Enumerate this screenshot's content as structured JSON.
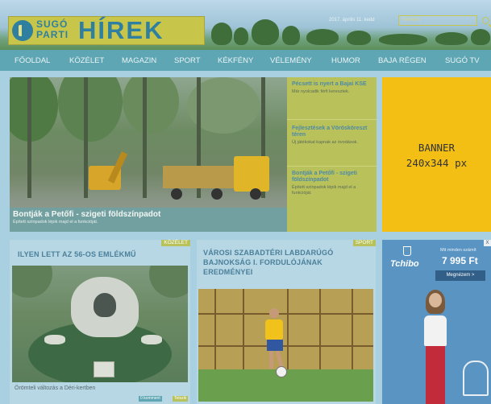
{
  "header": {
    "logo_line1": "SUGÓ",
    "logo_line2": "PARTI",
    "logo_word": "HÍREK",
    "date": "2017. április 11. kedd",
    "search_placeholder": "Keresés"
  },
  "nav": {
    "items": [
      "FŐOLDAL",
      "KÖZÉLET",
      "MAGAZIN",
      "SPORT",
      "KÉKFÉNY",
      "VÉLEMÉNY",
      "HUMOR",
      "BAJA RÉGEN",
      "SUGÓ TV"
    ]
  },
  "hero": {
    "title": "Bontják a Petőfi - szigeti földszínpadot",
    "subtitle": "Épített színpadok lépik majd el a funkcióját."
  },
  "side_news": [
    {
      "title": "Pécsett is nyert a Bajai KSE",
      "text": "Már nyolcadik férfi keresztek."
    },
    {
      "title": "Fejlesztések a Vörösköreszt téren",
      "text": "Új játékokat kapnak az óvodások."
    },
    {
      "title": "Bontják a Petőfi - szigeti földszínpadot",
      "text": "Épített színpadok lépik majd el a funkcióját."
    }
  ],
  "banner": {
    "line1": "BANNER",
    "line2": "240x344 px"
  },
  "article1": {
    "tag": "KÖZÉLET",
    "title": "ILYEN LETT AZ 56-OS EMLÉKMŰ",
    "caption": "Örömteli változás a Déri-kertben",
    "comments": "0 komment",
    "share": "Tetszik"
  },
  "article2": {
    "tag": "SPORT",
    "title_line1": "VÁROSI SZABADTÉRI LABDARÚGÓ",
    "title_line2": "BAJNOKSÁG I. FORDULÓJÁNAK",
    "title_line3": "EREDMÉNYEI"
  },
  "ad": {
    "brand": "Tchibo",
    "small_text": "Mit minden számít",
    "price": "7 995 Ft",
    "button": "Megnézem  >",
    "close": "X"
  },
  "colors": {
    "nav_bg": "#5ea6b3",
    "logo_bg": "#c8c64a",
    "banner_bg": "#f3bf14",
    "accent": "#b9c25a"
  }
}
